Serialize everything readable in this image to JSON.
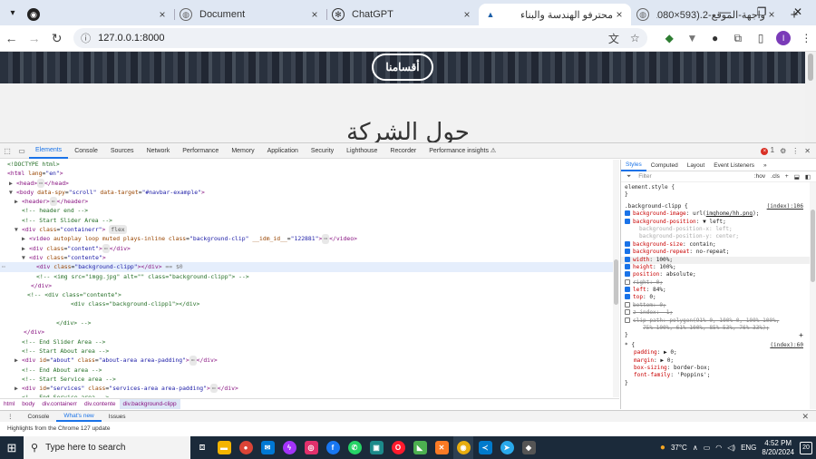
{
  "browser": {
    "tabs": [
      {
        "title": "",
        "icon": "github-icon",
        "active": false
      },
      {
        "title": "Document",
        "icon": "globe-icon",
        "active": false
      },
      {
        "title": "ChatGPT",
        "icon": "chatgpt-icon",
        "active": false
      },
      {
        "title": "محترفو الهندسة والبناء",
        "icon": "site-logo-icon",
        "active": true
      },
      {
        "title": "واجهة-الموقع-2.png (1080×593)",
        "icon": "globe-icon",
        "active": false
      }
    ],
    "new_tab": "+",
    "url": "127.0.0.1:8000",
    "profile_initial": "I"
  },
  "page": {
    "hero_button": "أقسامنا",
    "section_heading": "حول الشركة"
  },
  "devtools": {
    "tabs": [
      "Elements",
      "Console",
      "Sources",
      "Network",
      "Performance",
      "Memory",
      "Application",
      "Security",
      "Lighthouse",
      "Recorder",
      "Performance insights ⚠"
    ],
    "active_tab": "Elements",
    "error_count": "1",
    "breadcrumbs": [
      "html",
      "body",
      "div.containerr",
      "div.contente",
      "div.background-clipp"
    ],
    "styles_tabs": [
      "Styles",
      "Computed",
      "Layout",
      "Event Listeners",
      "»"
    ],
    "filter_placeholder": "Filter",
    "filter_hov": ":hov",
    "filter_cls": ".cls",
    "drawer_tabs": [
      "Console",
      "What's new",
      "Issues"
    ],
    "drawer_message": "Highlights from the Chrome 127 update"
  },
  "taskbar": {
    "search_placeholder": "Type here to search",
    "temperature": "37°C",
    "language": "ENG",
    "time": "4:52 PM",
    "date": "8/20/2024",
    "notifications": "20"
  }
}
